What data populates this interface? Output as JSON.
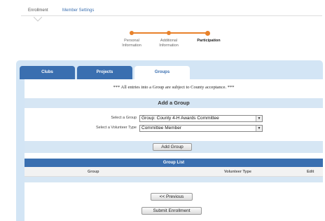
{
  "top_nav": {
    "enrollment_tab": "Enrollment",
    "member_settings_tab": "Member Settings"
  },
  "steps": {
    "items": [
      {
        "label": "Personal\nInformation",
        "state": "done"
      },
      {
        "label": "Additional\nInformation",
        "state": "done"
      },
      {
        "label": "Participation",
        "state": "current"
      }
    ],
    "color": "#e8822b"
  },
  "tabs": [
    {
      "label": "Clubs"
    },
    {
      "label": "Projects"
    },
    {
      "label": "Groups",
      "active": true
    }
  ],
  "notice": "*** All entries into a Group are subject to County acceptance. ***",
  "add_group": {
    "title": "Add a Group",
    "group_label": "Select a Group",
    "group_value": "Group: County 4-H Awards Committee",
    "volunteer_label": "Select a Volunteer Type",
    "volunteer_value": "Committee Member",
    "button": "Add Group"
  },
  "group_list": {
    "title": "Group List",
    "columns": [
      "Group",
      "Volunteer Type",
      "Edit"
    ]
  },
  "nav_buttons": {
    "previous": "<< Previous",
    "submit": "Submit Enrollment"
  },
  "colors": {
    "accent": "#3a6fb0",
    "panel": "#d3e5f5"
  }
}
